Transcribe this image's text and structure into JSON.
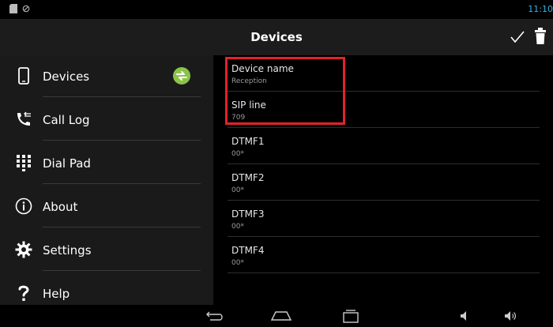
{
  "status": {
    "time": "11:10"
  },
  "actionbar": {
    "title": "Devices"
  },
  "sidebar": {
    "items": [
      {
        "label": "Devices"
      },
      {
        "label": "Call Log"
      },
      {
        "label": "Dial Pad"
      },
      {
        "label": "About"
      },
      {
        "label": "Settings"
      },
      {
        "label": "Help"
      }
    ]
  },
  "content": {
    "rows": [
      {
        "title": "Device name",
        "value": "Reception"
      },
      {
        "title": "SIP line",
        "value": "709"
      },
      {
        "title": "DTMF1",
        "value": "00*"
      },
      {
        "title": "DTMF2",
        "value": "00*"
      },
      {
        "title": "DTMF3",
        "value": "00*"
      },
      {
        "title": "DTMF4",
        "value": "00*"
      }
    ]
  },
  "colors": {
    "accent": "#33b5e5",
    "highlight": "#e2232a",
    "sync_badge": "#8bc34a"
  }
}
